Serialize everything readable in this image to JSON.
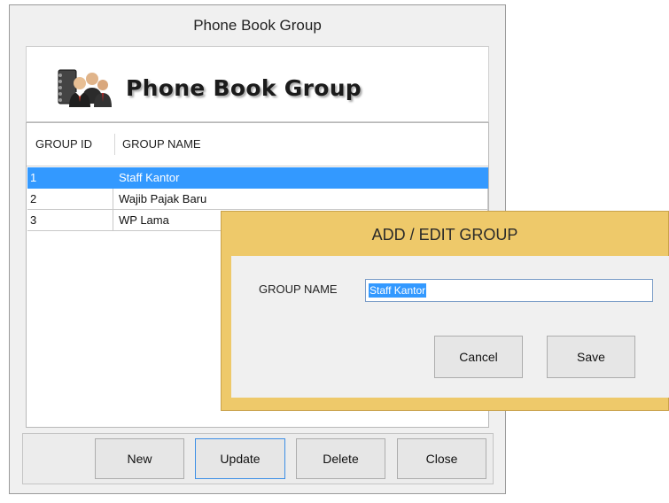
{
  "window": {
    "title": "Phone Book Group",
    "banner_text": "Phone Book Group",
    "banner_icon": "phonebook-people-icon"
  },
  "grid": {
    "columns": [
      "GROUP ID",
      "GROUP NAME"
    ],
    "rows": [
      {
        "id": "1",
        "name": "Staff Kantor",
        "selected": true
      },
      {
        "id": "2",
        "name": "Wajib Pajak Baru"
      },
      {
        "id": "3",
        "name": "WP Lama"
      }
    ],
    "selection_color": "#3399ff"
  },
  "buttons": {
    "new": "New",
    "update": "Update",
    "delete": "Delete",
    "close": "Close"
  },
  "dialog": {
    "title": "ADD / EDIT GROUP",
    "label": "GROUP NAME",
    "value": "Staff Kantor",
    "cancel": "Cancel",
    "save": "Save",
    "accent": "#eec96a"
  }
}
